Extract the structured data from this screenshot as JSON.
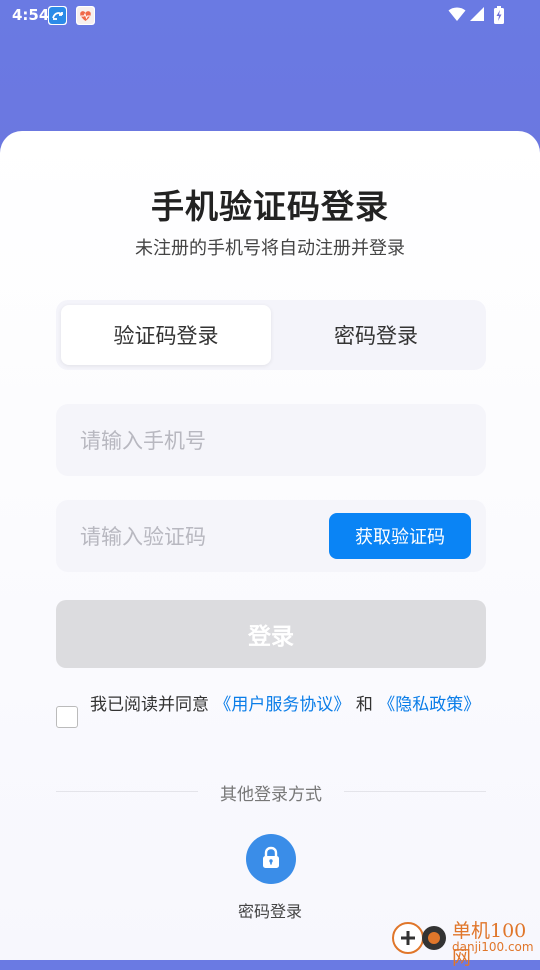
{
  "status_bar": {
    "time": "4:54"
  },
  "login": {
    "title": "手机验证码登录",
    "subtitle": "未注册的手机号将自动注册并登录",
    "tabs": [
      {
        "label": "验证码登录",
        "active": true
      },
      {
        "label": "密码登录",
        "active": false
      }
    ],
    "phone_placeholder": "请输入手机号",
    "code_placeholder": "请输入验证码",
    "get_code_label": "获取验证码",
    "login_button_label": "登录",
    "agreement": {
      "prefix": "我已阅读并同意",
      "user_agreement": "《用户服务协议》",
      "conjunction": "和",
      "privacy_policy": "《隐私政策》"
    },
    "other_methods_label": "其他登录方式",
    "password_login_label": "密码登录"
  },
  "watermark": {
    "name": "单机100网",
    "url": "danji100.com"
  },
  "colors": {
    "accent": "#0a84f5",
    "header_gradient_start": "#6a7ae3",
    "header_gradient_end": "#7466cf",
    "disabled_button": "#dcdcdf",
    "link": "#0a7de8"
  }
}
